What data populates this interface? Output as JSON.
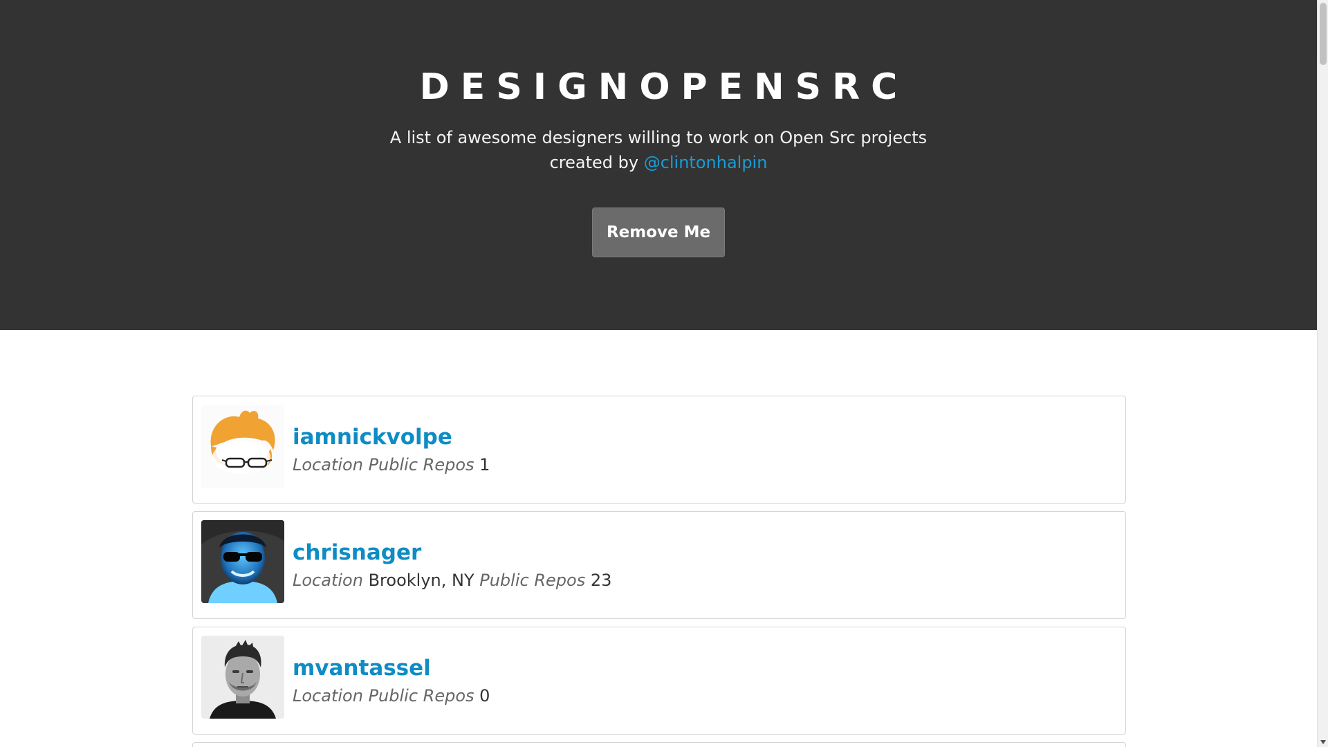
{
  "header": {
    "title": "DESIGNOPENSRC",
    "subtitle_line1": "A list of awesome designers willing to work on Open Src projects",
    "created_by_prefix": "created by ",
    "creator_link": "@clintonhalpin",
    "remove_button_label": "Remove Me"
  },
  "designers": [
    {
      "username": "iamnickvolpe",
      "location_label": "Location",
      "location_value": "",
      "repos_label": "Public Repos",
      "repos_value": "1",
      "avatar_icon": "orange-hair-glasses-cartoon-avatar"
    },
    {
      "username": "chrisnager",
      "location_label": "Location",
      "location_value": "Brooklyn, NY",
      "repos_label": "Public Repos",
      "repos_value": "23",
      "avatar_icon": "blue-tinted-sunglasses-photo-avatar"
    },
    {
      "username": "mvantassel",
      "location_label": "Location",
      "location_value": "",
      "repos_label": "Public Repos",
      "repos_value": "0",
      "avatar_icon": "grayscale-portrait-photo-avatar"
    }
  ],
  "colors": {
    "hero_background": "#333333",
    "link_blue": "#0e8cc4",
    "button_gray": "#6b6b6b"
  }
}
